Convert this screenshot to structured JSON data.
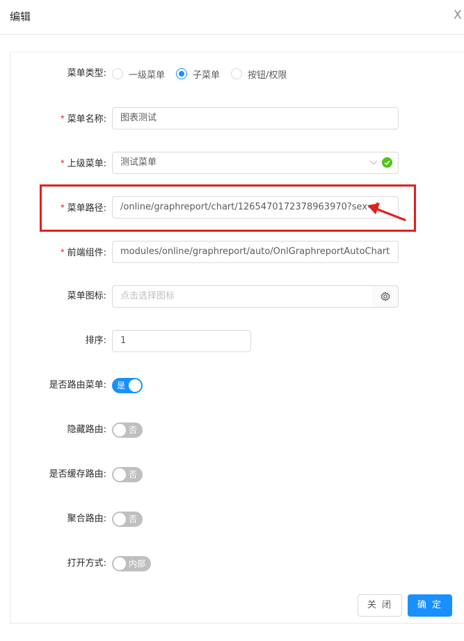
{
  "dialog": {
    "title": "编辑",
    "close_glyph": "X"
  },
  "form": {
    "menu_type": {
      "label": "菜单类型:",
      "options": [
        "一级菜单",
        "子菜单",
        "按钮/权限"
      ],
      "selected_index": 1
    },
    "menu_name": {
      "label": "菜单名称:",
      "value": "图表测试"
    },
    "parent_menu": {
      "label": "上级菜单:",
      "value": "测试菜单",
      "validated": true
    },
    "menu_path": {
      "label": "菜单路径:",
      "value": "/online/graphreport/chart/1265470172378963970?sex=1"
    },
    "component": {
      "label": "前端组件:",
      "value": "modules/online/graphreport/auto/OnlGraphreportAutoChart"
    },
    "icon": {
      "label": "菜单图标:",
      "placeholder": "点击选择图标",
      "button_icon": "gear-icon"
    },
    "sort": {
      "label": "排序:",
      "value": "1"
    },
    "is_route": {
      "label": "是否路由菜单:",
      "on": true,
      "text": "是"
    },
    "hidden_route": {
      "label": "隐藏路由:",
      "on": false,
      "text": "否"
    },
    "keep_alive": {
      "label": "是否缓存路由:",
      "on": false,
      "text": "否"
    },
    "always_show": {
      "label": "聚合路由:",
      "on": false,
      "text": "否"
    },
    "open_mode": {
      "label": "打开方式:",
      "on": false,
      "text": "内部"
    }
  },
  "footer": {
    "cancel_label": "关 闭",
    "ok_label": "确 定"
  },
  "colors": {
    "primary": "#1890ff",
    "required": "#f5222d",
    "annotation": "#e02020",
    "success": "#52c41a"
  }
}
